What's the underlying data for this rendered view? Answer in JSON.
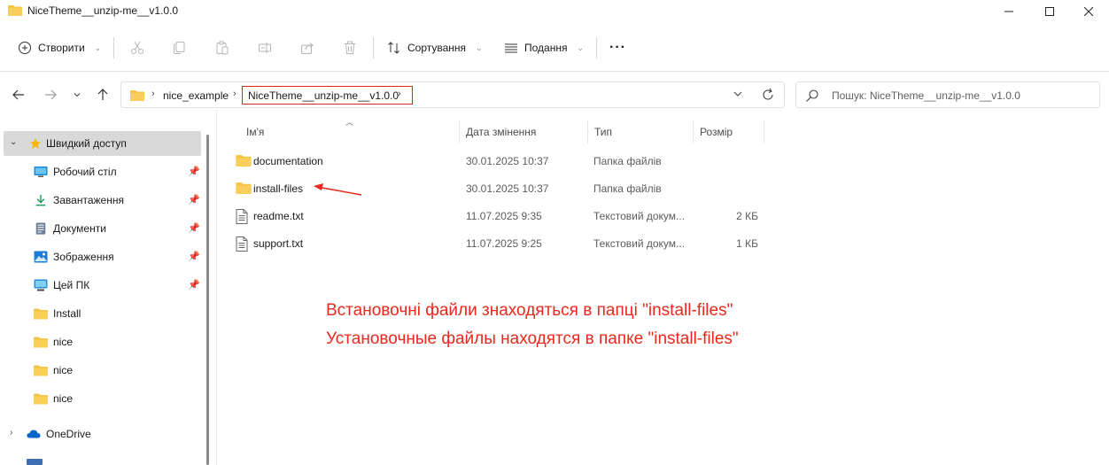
{
  "window": {
    "title": "NiceTheme__unzip-me__v1.0.0"
  },
  "toolbar": {
    "create_label": "Створити",
    "sort_label": "Сортування",
    "view_label": "Подання",
    "more_label": "···"
  },
  "address": {
    "crumbs": [
      "nice_example",
      "NiceTheme__unzip-me__v1.0.0"
    ]
  },
  "search": {
    "placeholder": "Пошук: NiceTheme__unzip-me__v1.0.0"
  },
  "sidebar": {
    "quick_access": "Швидкий доступ",
    "items": [
      {
        "label": "Робочий стіл",
        "icon": "desktop-icon",
        "pinned": true
      },
      {
        "label": "Завантаження",
        "icon": "download-icon",
        "pinned": true
      },
      {
        "label": "Документи",
        "icon": "documents-icon",
        "pinned": true
      },
      {
        "label": "Зображення",
        "icon": "pictures-icon",
        "pinned": true
      },
      {
        "label": "Цей ПК",
        "icon": "pc-icon",
        "pinned": true
      },
      {
        "label": "Install",
        "icon": "folder-icon",
        "pinned": false
      },
      {
        "label": "nice",
        "icon": "folder-icon",
        "pinned": false
      },
      {
        "label": "nice",
        "icon": "folder-icon",
        "pinned": false
      },
      {
        "label": "nice",
        "icon": "folder-icon",
        "pinned": false
      }
    ],
    "onedrive": "OneDrive"
  },
  "columns": {
    "name": "Ім'я",
    "date": "Дата змінення",
    "type": "Тип",
    "size": "Розмір"
  },
  "files": [
    {
      "name": "documentation",
      "date": "30.01.2025 10:37",
      "type": "Папка файлів",
      "size": "",
      "icon": "folder-icon"
    },
    {
      "name": "install-files",
      "date": "30.01.2025 10:37",
      "type": "Папка файлів",
      "size": "",
      "icon": "folder-icon"
    },
    {
      "name": "readme.txt",
      "date": "11.07.2025 9:35",
      "type": "Текстовий докум...",
      "size": "2 КБ",
      "icon": "text-file-icon"
    },
    {
      "name": "support.txt",
      "date": "11.07.2025 9:25",
      "type": "Текстовий докум...",
      "size": "1 КБ",
      "icon": "text-file-icon"
    }
  ],
  "annotation": {
    "line1": "Встановочні файли знаходяться в папці \"install-files\"",
    "line2": "Установочные файлы находятся в папке \"install-files\"",
    "color": "#e8291c"
  },
  "colors": {
    "folder": "#f5c443",
    "accent": "#0067c0",
    "highlight": "#e0241d"
  }
}
